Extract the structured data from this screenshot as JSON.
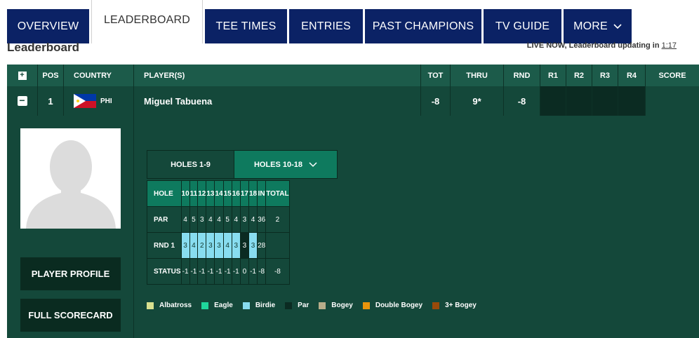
{
  "tabs": [
    {
      "label": "OVERVIEW"
    },
    {
      "label": "LEADERBOARD"
    },
    {
      "label": "TEE TIMES"
    },
    {
      "label": "ENTRIES"
    },
    {
      "label": "PAST CHAMPIONS"
    },
    {
      "label": "TV GUIDE"
    },
    {
      "label": "MORE"
    }
  ],
  "page_title": "Leaderboard",
  "live_now": {
    "text": "LIVE NOW, Leaderboard updating in",
    "countdown": "1:17"
  },
  "table_headers": {
    "expand": "+",
    "pos": "POS",
    "country": "COUNTRY",
    "players": "PLAYER(S)",
    "tot": "TOT",
    "thru": "THRU",
    "rnd": "RND",
    "r1": "R1",
    "r2": "R2",
    "r3": "R3",
    "r4": "R4",
    "score": "SCORE"
  },
  "player": {
    "collapse": "−",
    "pos": "1",
    "country": "PHI",
    "name": "Miguel Tabuena",
    "tot": "-8",
    "thru": "9*",
    "rnd": "-8"
  },
  "side_buttons": {
    "profile": "PLAYER PROFILE",
    "scorecard": "FULL SCORECARD"
  },
  "scorecard": {
    "tab_front": "HOLES 1-9",
    "tab_back": "HOLES 10-18",
    "row_labels": {
      "hole": "HOLE",
      "par": "PAR",
      "round": "RND 1",
      "status": "STATUS"
    },
    "holes": [
      "10",
      "11",
      "12",
      "13",
      "14",
      "15",
      "16",
      "17",
      "18",
      "IN",
      "TOTAL"
    ],
    "par": [
      "4",
      "5",
      "3",
      "4",
      "4",
      "5",
      "4",
      "3",
      "4",
      "36",
      "2"
    ],
    "round": [
      "3",
      "4",
      "2",
      "3",
      "3",
      "4",
      "3",
      "3",
      "3",
      "28",
      ""
    ],
    "round_types": [
      "birdie",
      "birdie",
      "birdie",
      "birdie",
      "birdie",
      "birdie",
      "birdie",
      "par",
      "birdie",
      "",
      ""
    ],
    "status": [
      "-1",
      "-1",
      "-1",
      "-1",
      "-1",
      "-1",
      "-1",
      "0",
      "-1",
      "-8",
      "-8"
    ]
  },
  "legend": [
    {
      "label": "Albatross",
      "color": "#d9e08f"
    },
    {
      "label": "Eagle",
      "color": "#1fd69b"
    },
    {
      "label": "Birdie",
      "color": "#88ddf0"
    },
    {
      "label": "Par",
      "color": "#0b2b22"
    },
    {
      "label": "Bogey",
      "color": "#b8ad8a"
    },
    {
      "label": "Double Bogey",
      "color": "#e8940c"
    },
    {
      "label": "3+ Bogey",
      "color": "#9a4a0a"
    }
  ],
  "colors": {
    "tab_navy": "#0b2265",
    "board_green": "#14483a",
    "header_green": "#1c5b4a",
    "hole_row_green": "#0e7a5e",
    "birdie": "#88ddf0"
  }
}
